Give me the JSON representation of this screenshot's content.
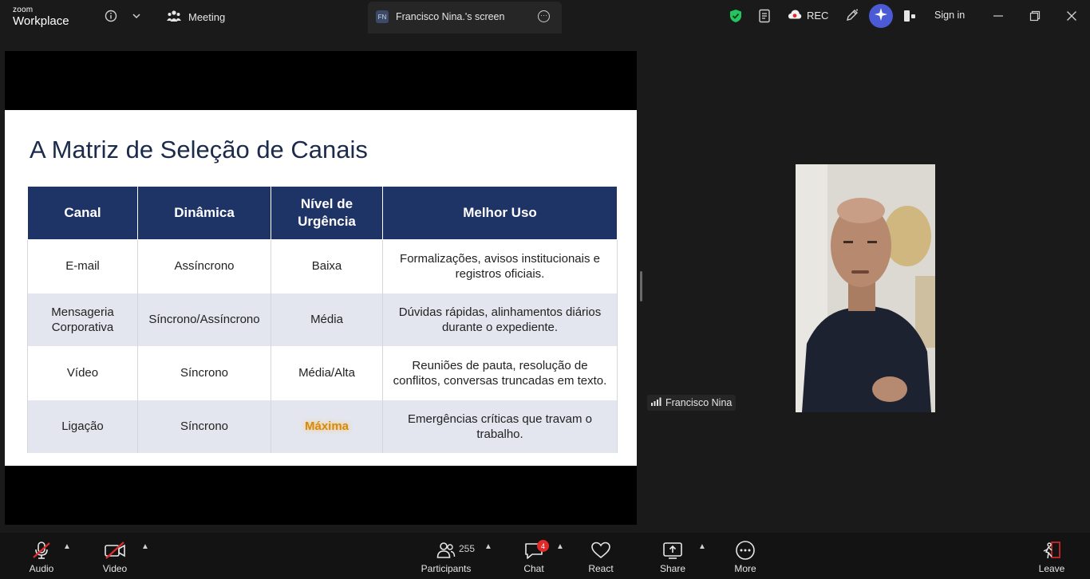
{
  "app": {
    "brand_top": "zoom",
    "brand_bottom": "Workplace"
  },
  "topbar": {
    "meeting_label": "Meeting",
    "screen_tab": {
      "badge": "FN",
      "label": "Francisco Nina.'s screen"
    },
    "rec_label": "REC",
    "signin_label": "Sign in"
  },
  "slide": {
    "title": "A Matriz de Seleção de Canais",
    "headers": [
      "Canal",
      "Dinâmica",
      "Nível de Urgência",
      "Melhor Uso"
    ],
    "rows": [
      [
        "E-mail",
        "Assíncrono",
        "Baixa",
        "Formalizações, avisos institucionais e registros oficiais."
      ],
      [
        "Mensageria Corporativa",
        "Síncrono/Assíncrono",
        "Média",
        "Dúvidas rápidas, alinhamentos diários durante o expediente."
      ],
      [
        "Vídeo",
        "Síncrono",
        "Média/Alta",
        "Reuniões de pauta, resolução de conflitos, conversas truncadas em texto."
      ],
      [
        "Ligação",
        "Síncrono",
        "Máxima",
        "Emergências críticas que travam o trabalho."
      ]
    ]
  },
  "participant": {
    "name": "Francisco Nina"
  },
  "toolbar": {
    "audio": "Audio",
    "video": "Video",
    "participants": "Participants",
    "participants_count": "255",
    "chat": "Chat",
    "chat_badge": "4",
    "react": "React",
    "share": "Share",
    "more": "More",
    "leave": "Leave"
  },
  "colors": {
    "header_blue": "#1e3366",
    "row_shade": "#e3e6ef",
    "highlight": "#d68a12",
    "muted_red": "#e02a2a",
    "ai_purple": "#4b5bd6",
    "shield_green": "#22c55e"
  }
}
